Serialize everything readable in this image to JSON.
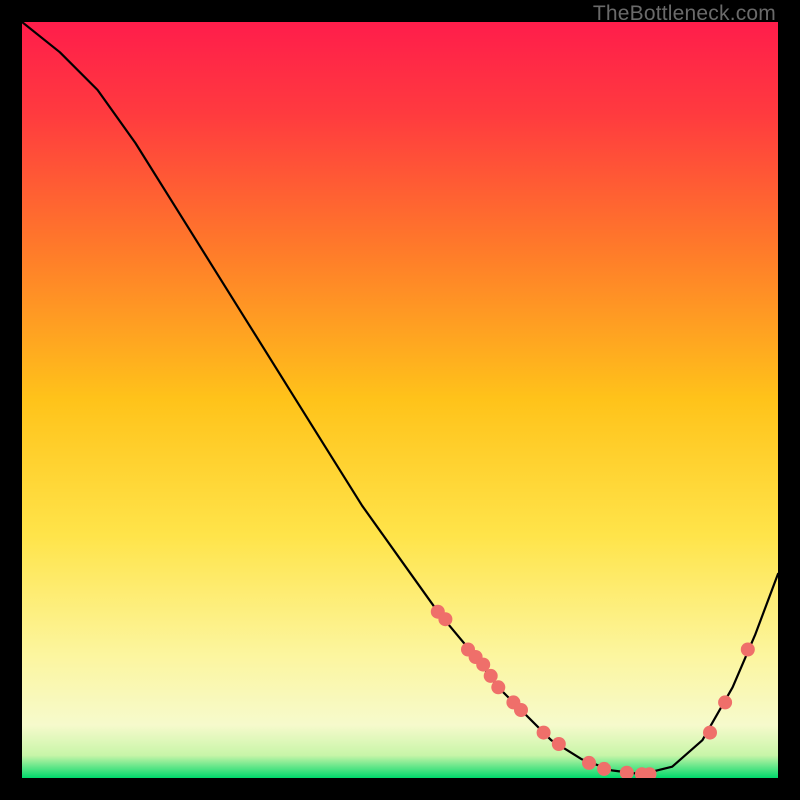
{
  "watermark": "TheBottleneck.com",
  "colors": {
    "gradient_top": "#ff1744",
    "gradient_mid_upper": "#ff5030",
    "gradient_mid": "#ffc107",
    "gradient_mid_lower": "#ffe44a",
    "gradient_lower": "#fff59d",
    "gradient_bottom": "#00e676",
    "curve": "#000000",
    "marker": "#ef6f6a",
    "frame": "#000000"
  },
  "chart_data": {
    "type": "line",
    "title": "",
    "xlabel": "",
    "ylabel": "",
    "xlim": [
      0,
      100
    ],
    "ylim": [
      0,
      100
    ],
    "grid": false,
    "legend": false,
    "series": [
      {
        "name": "bottleneck-curve",
        "x": [
          0,
          5,
          10,
          15,
          20,
          25,
          30,
          35,
          40,
          45,
          50,
          55,
          60,
          63,
          66,
          70,
          74,
          78,
          82,
          86,
          90,
          94,
          97,
          100
        ],
        "y": [
          100,
          96,
          91,
          84,
          76,
          68,
          60,
          52,
          44,
          36,
          29,
          22,
          16,
          12,
          9,
          5,
          2.5,
          1,
          0.5,
          1.5,
          5,
          12,
          19,
          27
        ]
      }
    ],
    "markers": [
      {
        "name": "curve-points",
        "x": [
          55,
          56,
          59,
          60,
          61,
          62,
          63,
          65,
          66,
          69,
          71,
          75,
          77,
          80,
          82,
          83,
          91,
          93,
          96
        ],
        "y": [
          22,
          21,
          17,
          16,
          15,
          13.5,
          12,
          10,
          9,
          6,
          4.5,
          2,
          1.2,
          0.7,
          0.5,
          0.5,
          6,
          10,
          17
        ]
      }
    ]
  }
}
